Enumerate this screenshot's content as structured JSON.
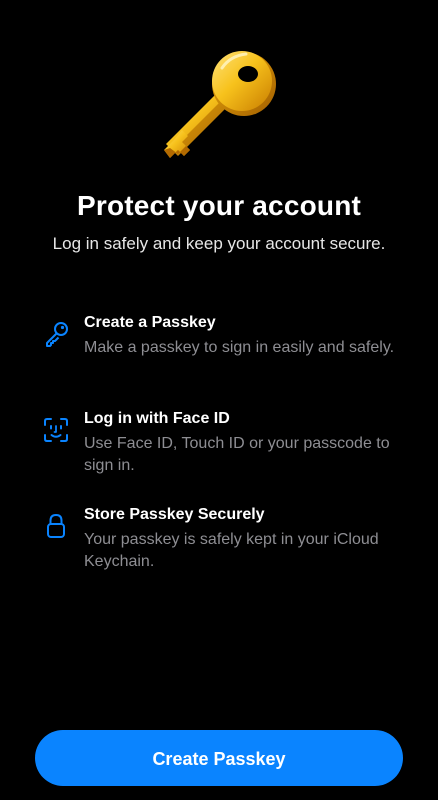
{
  "hero": {
    "icon": "golden-key-icon",
    "title": "Protect your account",
    "subtitle": "Log in safely and keep your account secure."
  },
  "features": [
    {
      "icon": "key-outline-icon",
      "title": "Create a Passkey",
      "description": "Make a passkey to sign in easily and safely."
    },
    {
      "icon": "face-id-icon",
      "title": "Log in with Face ID",
      "description": "Use Face ID, Touch ID or your passcode to sign in."
    },
    {
      "icon": "lock-icon",
      "title": "Store Passkey Securely",
      "description": "Your passkey is safely kept in your iCloud Keychain."
    }
  ],
  "cta": {
    "label": "Create Passkey"
  },
  "colors": {
    "background": "#000000",
    "accent": "#0a84ff",
    "secondary_text": "#8e8e93",
    "key_gold": "#f5b50a"
  }
}
